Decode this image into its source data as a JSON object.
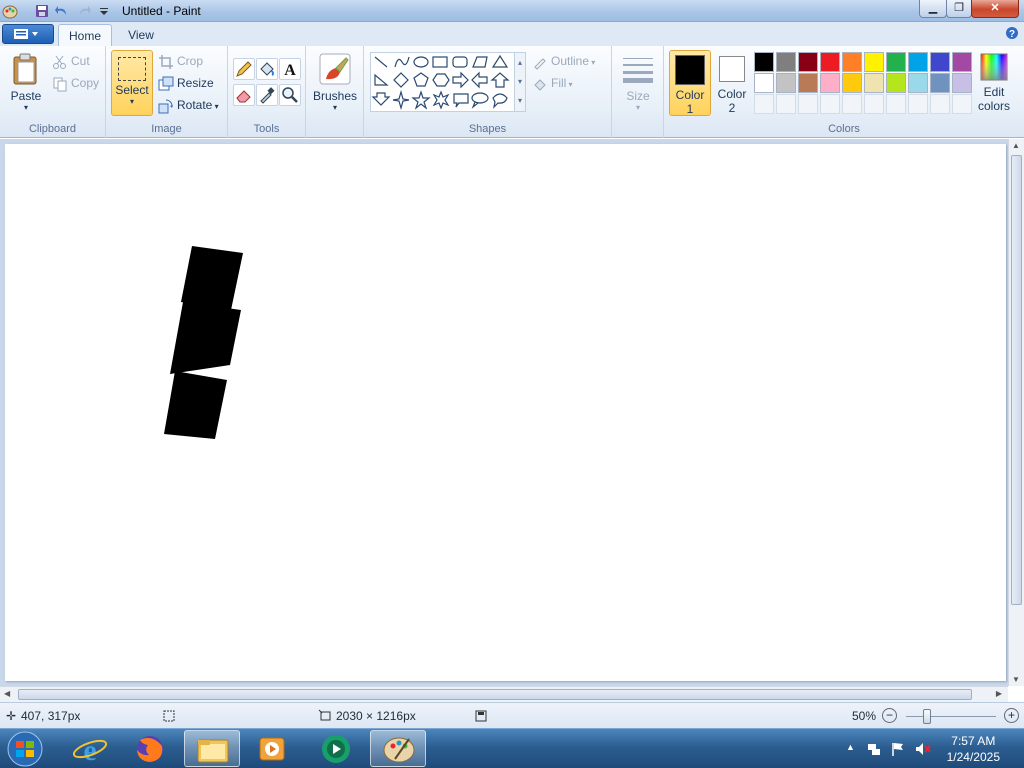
{
  "window": {
    "title": "Untitled - Paint"
  },
  "tabs": [
    {
      "label": "Home"
    },
    {
      "label": "View"
    }
  ],
  "ribbon": {
    "clipboard": {
      "group": "Clipboard",
      "paste": "Paste",
      "cut": "Cut",
      "copy": "Copy"
    },
    "image": {
      "group": "Image",
      "select": "Select",
      "crop": "Crop",
      "resize": "Resize",
      "rotate": "Rotate"
    },
    "tools": {
      "group": "Tools"
    },
    "brushes": {
      "label": "Brushes"
    },
    "shapes": {
      "group": "Shapes",
      "outline": "Outline",
      "fill": "Fill"
    },
    "size": {
      "label": "Size"
    },
    "colors": {
      "group": "Colors",
      "color1_line1": "Color",
      "color1_line2": "1",
      "color2_line1": "Color",
      "color2_line2": "2",
      "edit_line1": "Edit",
      "edit_line2": "colors",
      "color1_value": "#000000",
      "color2_value": "#ffffff"
    },
    "palette_row1": [
      "#000000",
      "#7f7f7f",
      "#880015",
      "#ed1c24",
      "#ff7f27",
      "#fff200",
      "#22b14c",
      "#00a2e8",
      "#3f48cc",
      "#a349a4"
    ],
    "palette_row2": [
      "#ffffff",
      "#c3c3c3",
      "#b97a57",
      "#ffaec9",
      "#ffc90e",
      "#efe4b0",
      "#b5e61d",
      "#99d9ea",
      "#7092be",
      "#c8bfe7"
    ]
  },
  "status": {
    "cursor_pos": "407, 317px",
    "canvas_size": "2030 × 1216px",
    "zoom": "50%"
  },
  "taskbar": {
    "time": "7:57 AM",
    "date": "1/24/2025"
  }
}
